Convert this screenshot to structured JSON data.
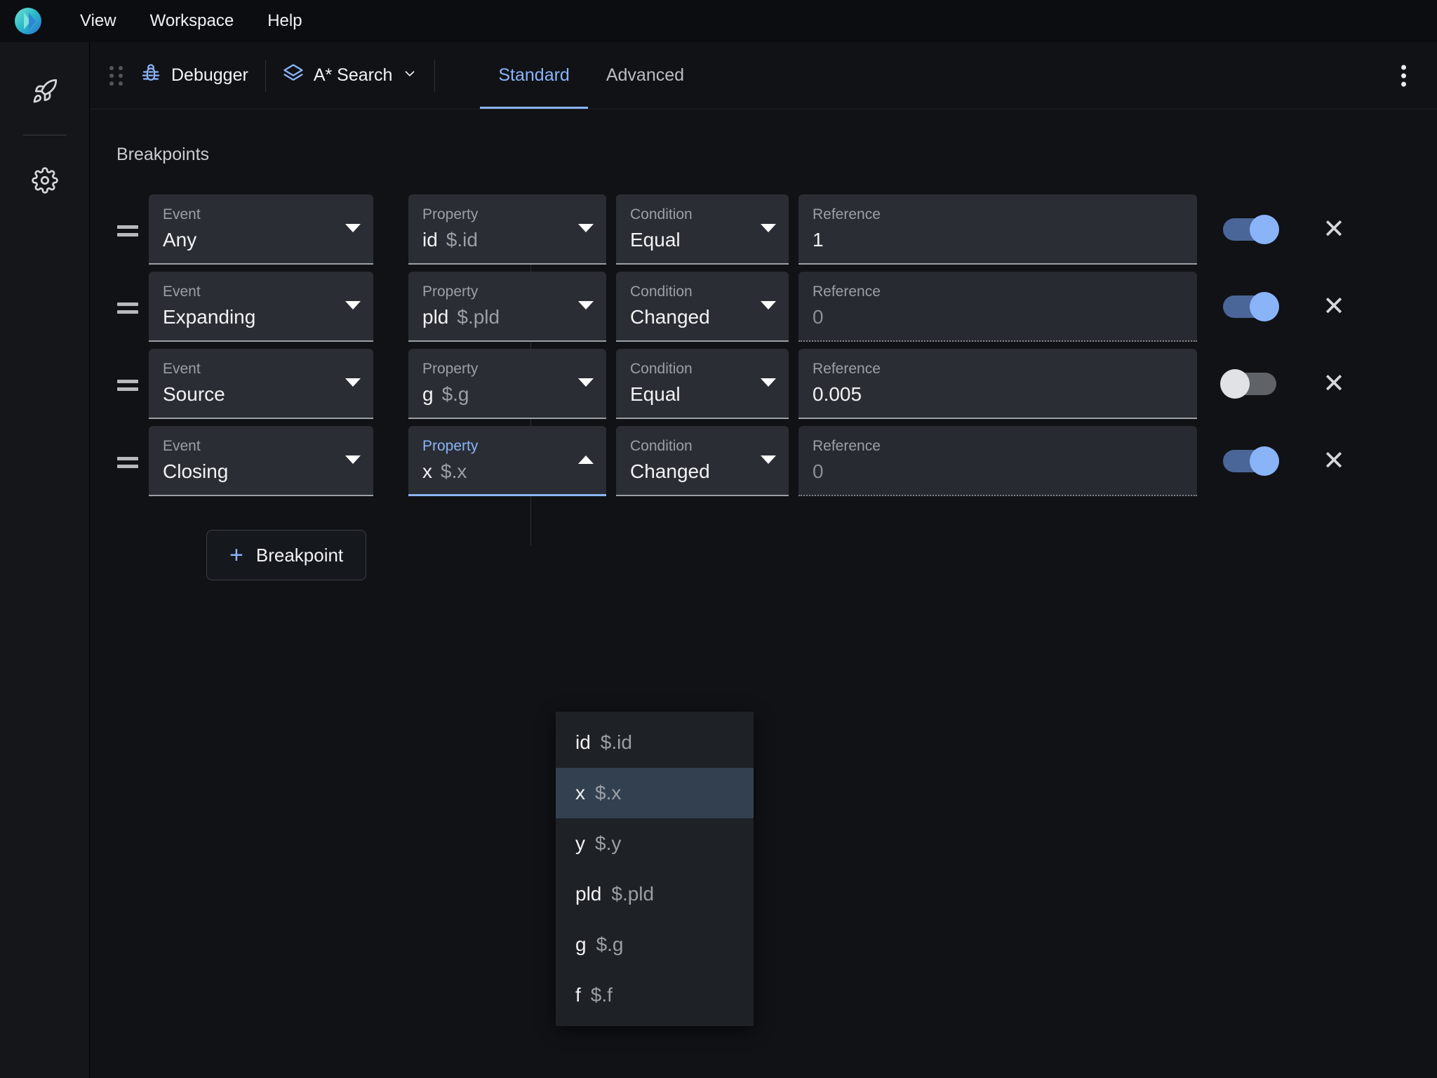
{
  "app": {
    "logo_icon": "app-logo-gradient-circle",
    "menu": [
      {
        "label": "View"
      },
      {
        "label": "Workspace"
      },
      {
        "label": "Help"
      }
    ]
  },
  "rail": {
    "items": [
      {
        "icon": "rocket-icon",
        "name": "launch"
      },
      {
        "icon": "gear-icon",
        "name": "settings"
      }
    ]
  },
  "toolbar": {
    "drag_handle_icon": "drag-dots-icon",
    "debugger": {
      "icon": "bug-icon",
      "label": "Debugger"
    },
    "algorithm": {
      "icon": "layers-icon",
      "label": "A* Search",
      "caret_icon": "chevron-down-icon"
    },
    "tabs": [
      {
        "label": "Standard",
        "active": true
      },
      {
        "label": "Advanced",
        "active": false
      }
    ],
    "overflow_icon": "kebab-menu-icon"
  },
  "content": {
    "section_title": "Breakpoints",
    "labels": {
      "event": "Event",
      "property": "Property",
      "condition": "Condition",
      "reference": "Reference"
    },
    "rows": [
      {
        "event": "Any",
        "property_name": "id",
        "property_path": "$.id",
        "condition": "Equal",
        "reference": "1",
        "reference_disabled": false,
        "enabled": true,
        "property_focused": false
      },
      {
        "event": "Expanding",
        "property_name": "pld",
        "property_path": "$.pld",
        "condition": "Changed",
        "reference": "0",
        "reference_disabled": true,
        "enabled": true,
        "property_focused": false
      },
      {
        "event": "Source",
        "property_name": "g",
        "property_path": "$.g",
        "condition": "Equal",
        "reference": "0.005",
        "reference_disabled": false,
        "enabled": false,
        "property_focused": false
      },
      {
        "event": "Closing",
        "property_name": "x",
        "property_path": "$.x",
        "condition": "Changed",
        "reference": "0",
        "reference_disabled": true,
        "enabled": true,
        "property_focused": true
      }
    ],
    "add_button": {
      "icon": "plus-icon",
      "label": "Breakpoint"
    }
  },
  "dropdown": {
    "open": true,
    "items": [
      {
        "name": "id",
        "path": "$.id",
        "selected": false
      },
      {
        "name": "x",
        "path": "$.x",
        "selected": true
      },
      {
        "name": "y",
        "path": "$.y",
        "selected": false
      },
      {
        "name": "pld",
        "path": "$.pld",
        "selected": false
      },
      {
        "name": "g",
        "path": "$.g",
        "selected": false
      },
      {
        "name": "f",
        "path": "$.f",
        "selected": false
      }
    ]
  },
  "colors": {
    "accent": "#8ab4f8",
    "bg": "#101216",
    "field_bg": "#2a2d33",
    "toggle_on_track": "#4a6698",
    "toggle_off_track": "#5f6368"
  }
}
